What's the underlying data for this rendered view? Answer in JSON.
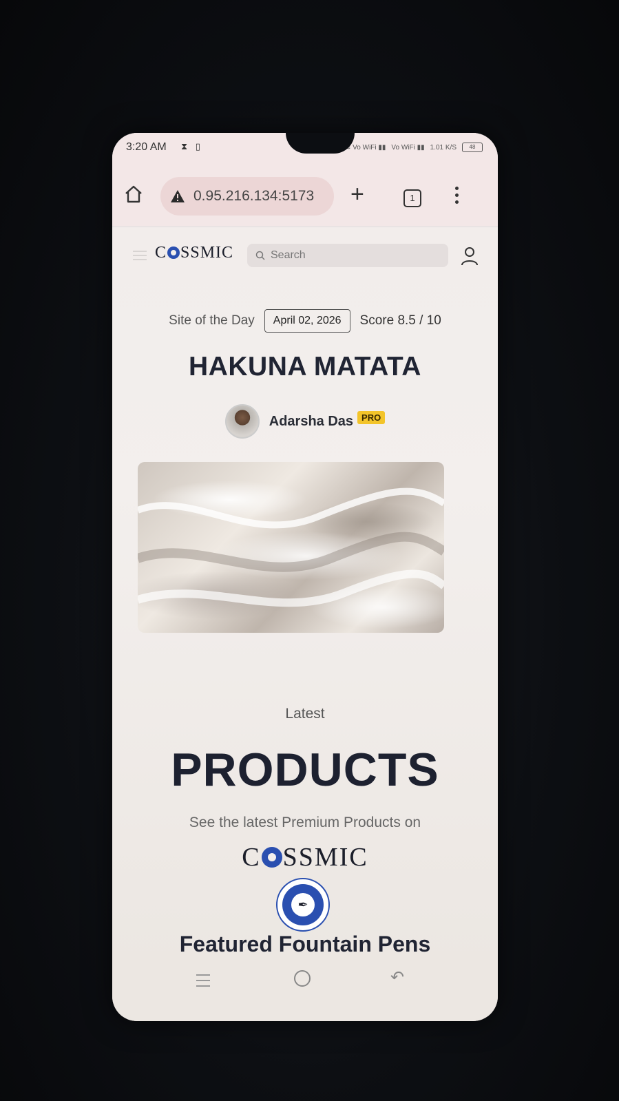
{
  "status_bar": {
    "time": "3:20 AM",
    "net_speed": "1.01 K/S",
    "battery": "48"
  },
  "browser": {
    "url": "0.95.216.134:5173",
    "tab_count": "1"
  },
  "site": {
    "logo": "COSSMIC",
    "search_placeholder": "Search"
  },
  "site_of_day": {
    "label": "Site of the Day",
    "date": "April 02, 2026",
    "score": "Score 8.5 / 10",
    "title": "HAKUNA MATATA",
    "author": "Adarsha Das",
    "badge": "PRO"
  },
  "products": {
    "eyebrow": "Latest",
    "heading": "PRODUCTS",
    "subtitle": "See the latest Premium Products on",
    "brand": "COSSMIC",
    "featured": "Featured Fountain Pens"
  },
  "colors": {
    "brand_blue": "#2a4fb0",
    "pro_badge": "#f3c42a",
    "heading": "#202433"
  }
}
